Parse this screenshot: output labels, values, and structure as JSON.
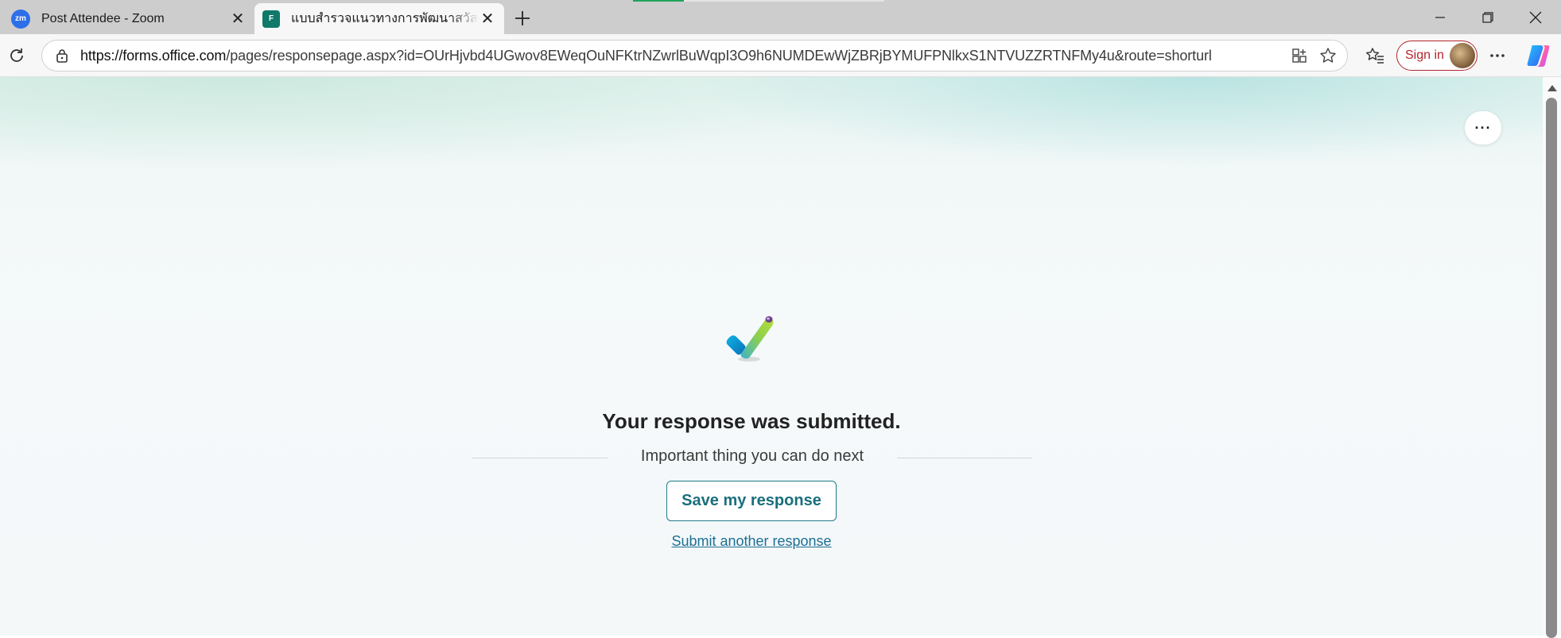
{
  "browser": {
    "tabs": [
      {
        "title": "Post Attendee - Zoom",
        "favicon": "zm",
        "active": false
      },
      {
        "title": "แบบสำรวจแนวทางการพัฒนาสวัสดิการ",
        "favicon": "F",
        "active": true
      }
    ],
    "url": {
      "host": "https://forms.office.com",
      "path": "/pages/responsepage.aspx?id=OUrHjvbd4UGwov8EWeqOuNFKtrNZwrlBuWqpI3O9h6NUMDEwWjZBRjBYMUFPNlkxS1NTVUZZRTNFMy4u&route=shorturl"
    },
    "sign_in_label": "Sign in",
    "accent_color": "#b3262d"
  },
  "page": {
    "more_label": "···",
    "message": "Your response was submitted.",
    "next_heading": "Important thing you can do next",
    "save_button": "Save my response",
    "another_link": "Submit another response",
    "accent_color": "#1a6f7c"
  }
}
